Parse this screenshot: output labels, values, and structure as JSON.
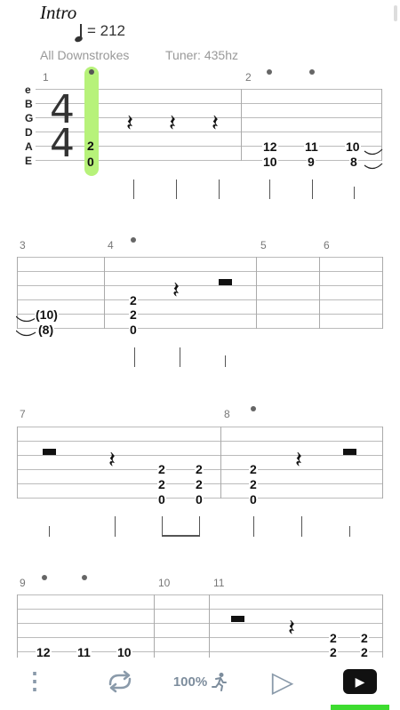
{
  "header": {
    "title": "Intro",
    "tempo": "= 212",
    "stroke_mode": "All Downstrokes",
    "tuner": "Tuner: 435hz"
  },
  "strings": [
    "e",
    "B",
    "G",
    "D",
    "A",
    "E"
  ],
  "time_signature": {
    "top": "4",
    "bottom": "4"
  },
  "measures": {
    "m1": "1",
    "m2": "2",
    "m3": "3",
    "m4": "4",
    "m5": "5",
    "m6": "6",
    "m7": "7",
    "m8": "8",
    "m9": "9",
    "m10": "10",
    "m11": "11"
  },
  "frets": {
    "r1_b1_a": "2",
    "r1_b1_e": "0",
    "r1_c1_a": "12",
    "r1_c1_e": "10",
    "r1_c2_a": "11",
    "r1_c2_e": "9",
    "r1_c3_a": "10",
    "r1_c3_e": "8",
    "r2_t_a": "(10)",
    "r2_t_e": "(8)",
    "r2_m4_d": "2",
    "r2_m4_a": "2",
    "r2_m4_e": "0",
    "r3_c1_d": "2",
    "r3_c1_a": "2",
    "r3_c1_e": "0",
    "r3_c2_d": "2",
    "r3_c2_a": "2",
    "r3_c2_e": "0",
    "r3_c3_d": "2",
    "r3_c3_a": "2",
    "r3_c3_e": "0",
    "r4_c1": "12",
    "r4_c2": "11",
    "r4_c3": "10",
    "r4_c4": "2",
    "r4_c5": "2",
    "r4_c6": "2",
    "r4_c7": "2"
  },
  "rest_glyph": "𝄽",
  "toolbar": {
    "menu_icon": "⋮",
    "speed": "100%",
    "play_icon": "▷",
    "youtube_icon": "▶"
  }
}
